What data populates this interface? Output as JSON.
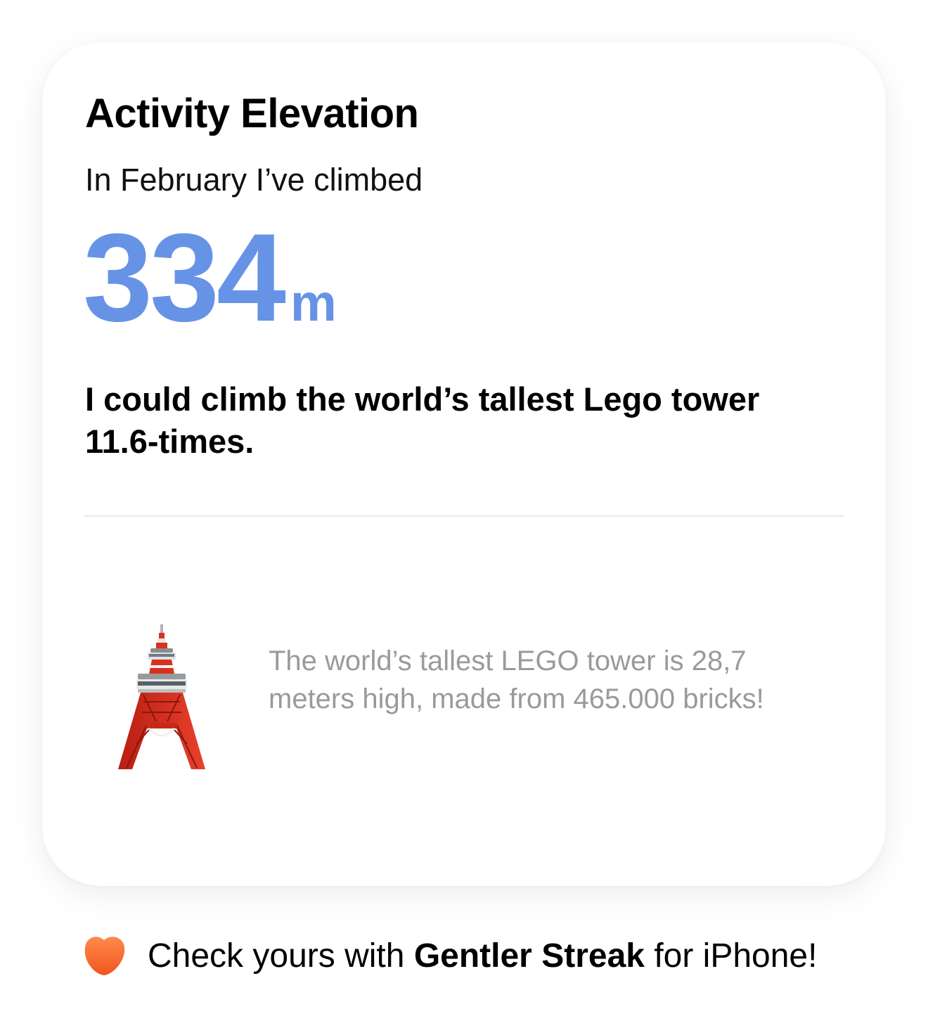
{
  "card": {
    "title": "Activity Elevation",
    "subtitle": "In February I’ve climbed",
    "metric": {
      "value": "334",
      "unit": "m",
      "color": "#6793e6"
    },
    "comparison": "I could climb the world’s tallest Lego tower 11.6-times.",
    "fact": {
      "icon": "tokyo-tower-icon",
      "text": "The world’s tallest LEGO tower is 28,7 meters high, made from 465.000 bricks!"
    }
  },
  "footer": {
    "icon": "gentler-streak-heart-icon",
    "prefix": "Check yours with",
    "app_name": "Gentler Streak",
    "suffix": "for iPhone!",
    "brand_color": "#f26a2e"
  }
}
